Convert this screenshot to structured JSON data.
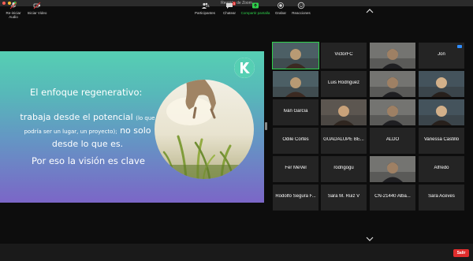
{
  "window": {
    "title": "Reunión de Zoom"
  },
  "slide": {
    "heading": "El enfoque regenerativo:",
    "body_main_1": "trabaja desde el potencial",
    "body_small": "(lo que podría ser un lugar, un proyecto);",
    "body_main_2": "no solo desde lo que es.",
    "closing": "Por eso la visión es clave",
    "logo_icon": "k-logo-icon"
  },
  "participants": [
    {
      "name": "",
      "video": true,
      "active": true
    },
    {
      "name": "VictorFC"
    },
    {
      "name": "",
      "video": true
    },
    {
      "name": "Jon"
    },
    {
      "name": "",
      "video": true
    },
    {
      "name": "Luis Rodriguez"
    },
    {
      "name": "",
      "video": true
    },
    {
      "name": "",
      "video": true
    },
    {
      "name": "Iván García"
    },
    {
      "name": "",
      "video": true
    },
    {
      "name": "",
      "video": true
    },
    {
      "name": "",
      "video": true
    },
    {
      "name": "Odile Cortés"
    },
    {
      "name": "GUADALUPE BE..."
    },
    {
      "name": "ALDO"
    },
    {
      "name": "Vanessa Castillo"
    },
    {
      "name": "Fer MeVel"
    },
    {
      "name": "rodrigogu"
    },
    {
      "name": "",
      "video": true
    },
    {
      "name": "Alfredo"
    },
    {
      "name": "Rodolfo Segura F..."
    },
    {
      "name": "Sara M. Ruiz V"
    },
    {
      "name": "CN-21440 Alba..."
    },
    {
      "name": "Sara Aceves"
    }
  ],
  "toolbar": {
    "unmute": "Re-iniciar Audio",
    "start_video": "Iniciar Video",
    "participants": "Participantes",
    "participants_count": "31",
    "chat": "Chatear",
    "chat_badge": "3",
    "share": "Compartir pantalla",
    "record": "Grabar",
    "reactions": "Reacciones",
    "end": "Salir"
  },
  "colors": {
    "accent_green": "#2fd14b",
    "end_red": "#e02d2d",
    "zoom_blue": "#2d8cff"
  }
}
